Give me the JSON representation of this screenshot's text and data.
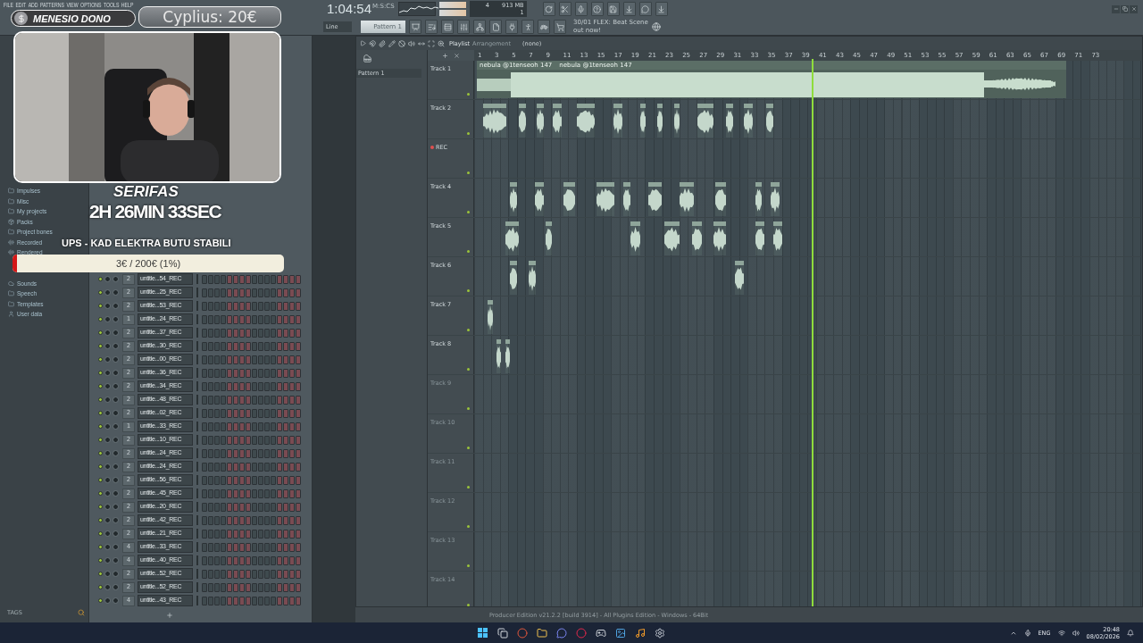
{
  "menu": [
    "FILE",
    "EDIT",
    "ADD",
    "PATTERNS",
    "VIEW",
    "OPTIONS",
    "TOOLS",
    "HELP"
  ],
  "transport": {
    "time": "1:04:54",
    "time_unit": "M:S:CS"
  },
  "monitor": {
    "cpu": "4",
    "memory": "913 MB",
    "polyphony": "1"
  },
  "snap": "Line",
  "pattern": "Pattern 1",
  "news": {
    "title": "30/01  FLEX: Beat Scene",
    "subtitle": "out now!"
  },
  "browser": {
    "items": [
      {
        "label": "Impulses",
        "kind": "folder"
      },
      {
        "label": "Misc",
        "kind": "folder"
      },
      {
        "label": "My projects",
        "kind": "folder"
      },
      {
        "label": "Packs",
        "kind": "packs"
      },
      {
        "label": "Project bones",
        "kind": "folder"
      },
      {
        "label": "Recorded",
        "kind": "audio"
      },
      {
        "label": "Rendered",
        "kind": "audio"
      },
      {
        "label": "Sounds",
        "kind": "cloud"
      },
      {
        "label": "Speech",
        "kind": "folder"
      },
      {
        "label": "Templates",
        "kind": "folder"
      },
      {
        "label": "User data",
        "kind": "user"
      }
    ],
    "tags_label": "TAGS"
  },
  "channel_rack": {
    "channels": [
      {
        "name": "untitle...54_REC",
        "route": "2"
      },
      {
        "name": "untitle...25_REC",
        "route": "2"
      },
      {
        "name": "untitle...53_REC",
        "route": "2"
      },
      {
        "name": "untitle...24_REC",
        "route": "1"
      },
      {
        "name": "untitle...37_REC",
        "route": "2"
      },
      {
        "name": "untitle...30_REC",
        "route": "2"
      },
      {
        "name": "untitle...00_REC",
        "route": "2"
      },
      {
        "name": "untitle...36_REC",
        "route": "2"
      },
      {
        "name": "untitle...34_REC",
        "route": "2"
      },
      {
        "name": "untitle...48_REC",
        "route": "2"
      },
      {
        "name": "untitle...02_REC",
        "route": "2"
      },
      {
        "name": "untitle...33_REC",
        "route": "1"
      },
      {
        "name": "untitle...10_REC",
        "route": "2"
      },
      {
        "name": "untitle...24_REC",
        "route": "2"
      },
      {
        "name": "untitle...24_REC",
        "route": "2"
      },
      {
        "name": "untitle...56_REC",
        "route": "2"
      },
      {
        "name": "untitle...45_REC",
        "route": "2"
      },
      {
        "name": "untitle...20_REC",
        "route": "2"
      },
      {
        "name": "untitle...42_REC",
        "route": "2"
      },
      {
        "name": "untitle...21_REC",
        "route": "2"
      },
      {
        "name": "untitle...33_REC",
        "route": "4"
      },
      {
        "name": "untitle...40_REC",
        "route": "4"
      },
      {
        "name": "untitle...52_REC",
        "route": "2"
      },
      {
        "name": "untitle...52_REC",
        "route": "2"
      },
      {
        "name": "untitle...43_REC",
        "route": "4"
      }
    ]
  },
  "playlist": {
    "title": "Playlist",
    "subtitle": "Arrangement",
    "arrangement": "(none)",
    "patterns": [
      {
        "label": "Pattern 1"
      }
    ],
    "ruler": [
      "1",
      "3",
      "5",
      "7",
      "9",
      "11",
      "13",
      "15",
      "17",
      "19",
      "21",
      "23",
      "25",
      "27",
      "29",
      "31",
      "33",
      "35",
      "37",
      "39",
      "41",
      "43",
      "45",
      "47",
      "49",
      "51",
      "53",
      "55",
      "57",
      "59",
      "61",
      "63",
      "65",
      "67",
      "69",
      "71",
      "73"
    ],
    "tracks": [
      {
        "name": "Track 1",
        "recording": false,
        "empty": false,
        "clip_labels": [
          "nebula @1tenseoh 147",
          "nebula @1tenseoh 147"
        ]
      },
      {
        "name": "Track 2",
        "recording": false,
        "empty": false
      },
      {
        "name": "REC",
        "recording": true,
        "empty": false
      },
      {
        "name": "Track 4",
        "recording": false,
        "empty": false
      },
      {
        "name": "Track 5",
        "recording": false,
        "empty": false
      },
      {
        "name": "Track 6",
        "recording": false,
        "empty": false
      },
      {
        "name": "Track 7",
        "recording": false,
        "empty": false
      },
      {
        "name": "Track 8",
        "recording": false,
        "empty": false
      },
      {
        "name": "Track 9",
        "recording": false,
        "empty": true
      },
      {
        "name": "Track 10",
        "recording": false,
        "empty": true
      },
      {
        "name": "Track 11",
        "recording": false,
        "empty": true
      },
      {
        "name": "Track 12",
        "recording": false,
        "empty": true
      },
      {
        "name": "Track 13",
        "recording": false,
        "empty": true
      },
      {
        "name": "Track 14",
        "recording": false,
        "empty": true
      }
    ]
  },
  "status_bar": "Producer Edition v21.2.2 [build 3914] - All Plugins Edition - Windows - 64Bit",
  "stream_overlay": {
    "donation_label": "MENESIO DONO",
    "top_donor": "Cyplius: 20€",
    "streamer": "SERIFAS",
    "timer": "2H 26MIN 33SEC",
    "goal_title": "UPS - KAD ELEKTRA BUTU STABILI",
    "goal_text": "3€ / 200€ (1%)",
    "goal": {
      "level": 0.015
    }
  },
  "taskbar": {
    "language": "ENG",
    "time": "20:48",
    "date": "08/02/2026"
  }
}
